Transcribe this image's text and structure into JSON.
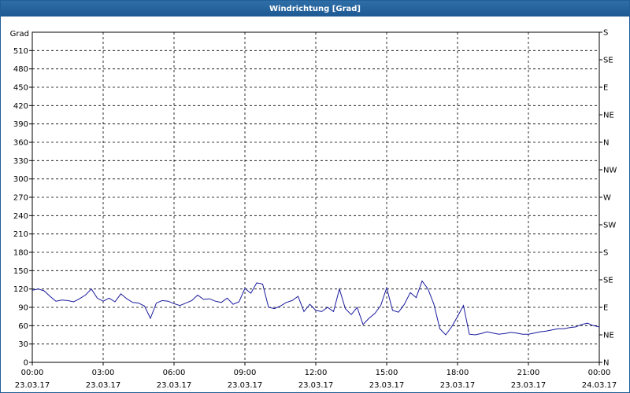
{
  "window": {
    "title": "Windrichtung [Grad]"
  },
  "chart_data": {
    "type": "line",
    "title": "Windrichtung [Grad]",
    "ylabel": "Grad",
    "ylim": [
      0,
      540
    ],
    "xlim_hours": [
      0,
      24
    ],
    "grid": true,
    "y_ticks": [
      0,
      30,
      60,
      90,
      120,
      150,
      180,
      210,
      240,
      270,
      300,
      330,
      360,
      390,
      420,
      450,
      480,
      510
    ],
    "y2_labels": [
      {
        "value": 0,
        "label": "N"
      },
      {
        "value": 45,
        "label": "NE"
      },
      {
        "value": 90,
        "label": "E"
      },
      {
        "value": 135,
        "label": "SE"
      },
      {
        "value": 180,
        "label": "S"
      },
      {
        "value": 225,
        "label": "SW"
      },
      {
        "value": 270,
        "label": "W"
      },
      {
        "value": 315,
        "label": "NW"
      },
      {
        "value": 360,
        "label": "N"
      },
      {
        "value": 405,
        "label": "NE"
      },
      {
        "value": 450,
        "label": "E"
      },
      {
        "value": 495,
        "label": "SE"
      },
      {
        "value": 540,
        "label": "S"
      }
    ],
    "x_ticks": [
      {
        "hour": 0,
        "time": "00:00",
        "date": "23.03.17"
      },
      {
        "hour": 3,
        "time": "03:00",
        "date": "23.03.17"
      },
      {
        "hour": 6,
        "time": "06:00",
        "date": "23.03.17"
      },
      {
        "hour": 9,
        "time": "09:00",
        "date": "23.03.17"
      },
      {
        "hour": 12,
        "time": "12:00",
        "date": "23.03.17"
      },
      {
        "hour": 15,
        "time": "15:00",
        "date": "23.03.17"
      },
      {
        "hour": 18,
        "time": "18:00",
        "date": "23.03.17"
      },
      {
        "hour": 21,
        "time": "21:00",
        "date": "23.03.17"
      },
      {
        "hour": 24,
        "time": "00:00",
        "date": "24.03.17"
      }
    ],
    "line_color": "#1a1a9e",
    "series": [
      {
        "x": [
          0,
          0.25,
          0.5,
          0.75,
          1,
          1.25,
          1.5,
          1.75,
          2,
          2.25,
          2.5,
          2.75,
          3,
          3.25,
          3.5,
          3.75,
          4,
          4.25,
          4.5,
          4.75,
          5,
          5.25,
          5.5,
          5.75,
          6,
          6.25,
          6.5,
          6.75,
          7,
          7.25,
          7.5,
          7.75,
          8,
          8.25,
          8.5,
          8.75,
          9,
          9.25,
          9.5,
          9.75,
          10,
          10.25,
          10.5,
          10.75,
          11,
          11.25,
          11.5,
          11.75,
          12,
          12.25,
          12.5,
          12.75,
          13,
          13.25,
          13.5,
          13.75,
          14,
          14.25,
          14.5,
          14.75,
          15,
          15.25,
          15.5,
          15.75,
          16,
          16.25,
          16.5,
          16.75,
          17,
          17.25,
          17.5,
          17.75,
          18,
          18.25,
          18.5,
          18.75,
          19,
          19.25,
          19.5,
          19.75,
          20,
          20.25,
          20.5,
          20.75,
          21,
          21.25,
          21.5,
          21.75,
          22,
          22.25,
          22.5,
          22.75,
          23,
          23.25,
          23.5,
          23.75,
          24
        ],
        "values": [
          118,
          120,
          117,
          108,
          100,
          102,
          101,
          99,
          104,
          110,
          120,
          105,
          100,
          105,
          99,
          112,
          104,
          98,
          97,
          92,
          72,
          97,
          101,
          100,
          96,
          93,
          97,
          101,
          110,
          103,
          104,
          100,
          98,
          105,
          95,
          99,
          121,
          113,
          130,
          128,
          90,
          88,
          92,
          98,
          101,
          108,
          83,
          95,
          85,
          83,
          90,
          83,
          120,
          88,
          78,
          90,
          62,
          72,
          80,
          93,
          122,
          85,
          82,
          95,
          114,
          106,
          133,
          120,
          95,
          55,
          45,
          58,
          75,
          93,
          46,
          45,
          47,
          50,
          48,
          46,
          47,
          49,
          48,
          46,
          46,
          48,
          50,
          51,
          53,
          55,
          55,
          57,
          58,
          62,
          64,
          60,
          58
        ]
      }
    ]
  }
}
